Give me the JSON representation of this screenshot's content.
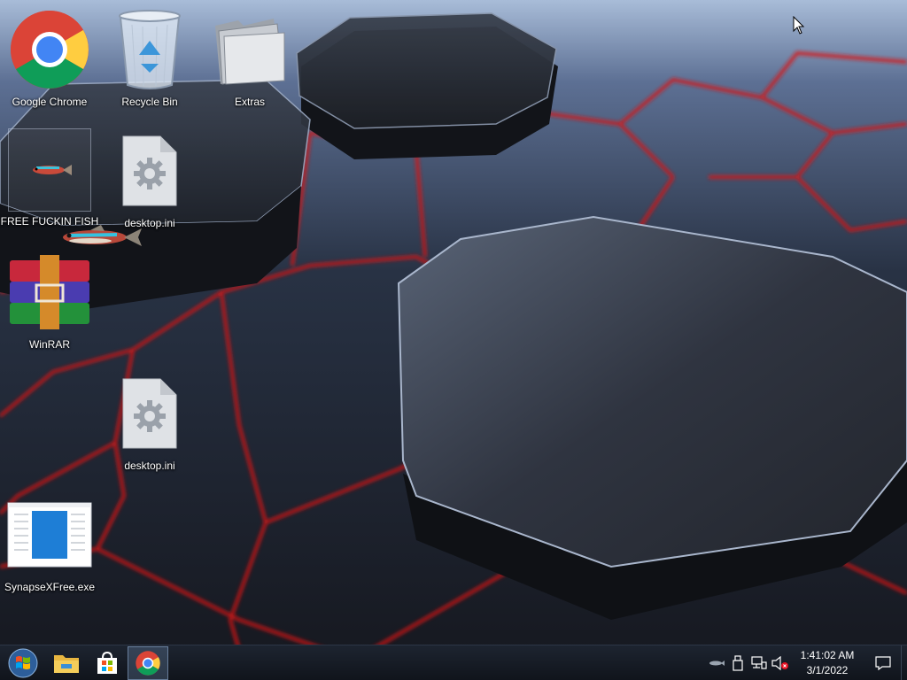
{
  "desktop": {
    "icons": [
      {
        "label": "Google Chrome",
        "icon": "chrome-icon"
      },
      {
        "label": "Recycle Bin",
        "icon": "recycle-bin-icon"
      },
      {
        "label": "Extras",
        "icon": "folder-icon"
      },
      {
        "label": "FREE FUCKIN FISH",
        "icon": "fish-icon"
      },
      {
        "label": "desktop.ini",
        "icon": "settings-file-icon"
      },
      {
        "label": "WinRAR",
        "icon": "winrar-icon"
      },
      {
        "label": "desktop.ini",
        "icon": "settings-file-icon"
      },
      {
        "label": "SynapseXFree.exe",
        "icon": "application-icon"
      }
    ]
  },
  "taskbar": {
    "buttons": [
      {
        "name": "start-button",
        "icon": "windows-logo-icon"
      },
      {
        "name": "file-explorer",
        "icon": "folder-icon"
      },
      {
        "name": "microsoft-store",
        "icon": "store-icon"
      },
      {
        "name": "google-chrome",
        "icon": "chrome-icon",
        "active": true
      }
    ],
    "tray": {
      "icons": [
        "fish-tray-icon",
        "usb-icon",
        "network-icon",
        "volume-muted-icon"
      ],
      "time": "1:41:02 AM",
      "date": "3/1/2022"
    }
  },
  "colors": {
    "accent_red": "#e02020",
    "taskbar": "#131822"
  }
}
